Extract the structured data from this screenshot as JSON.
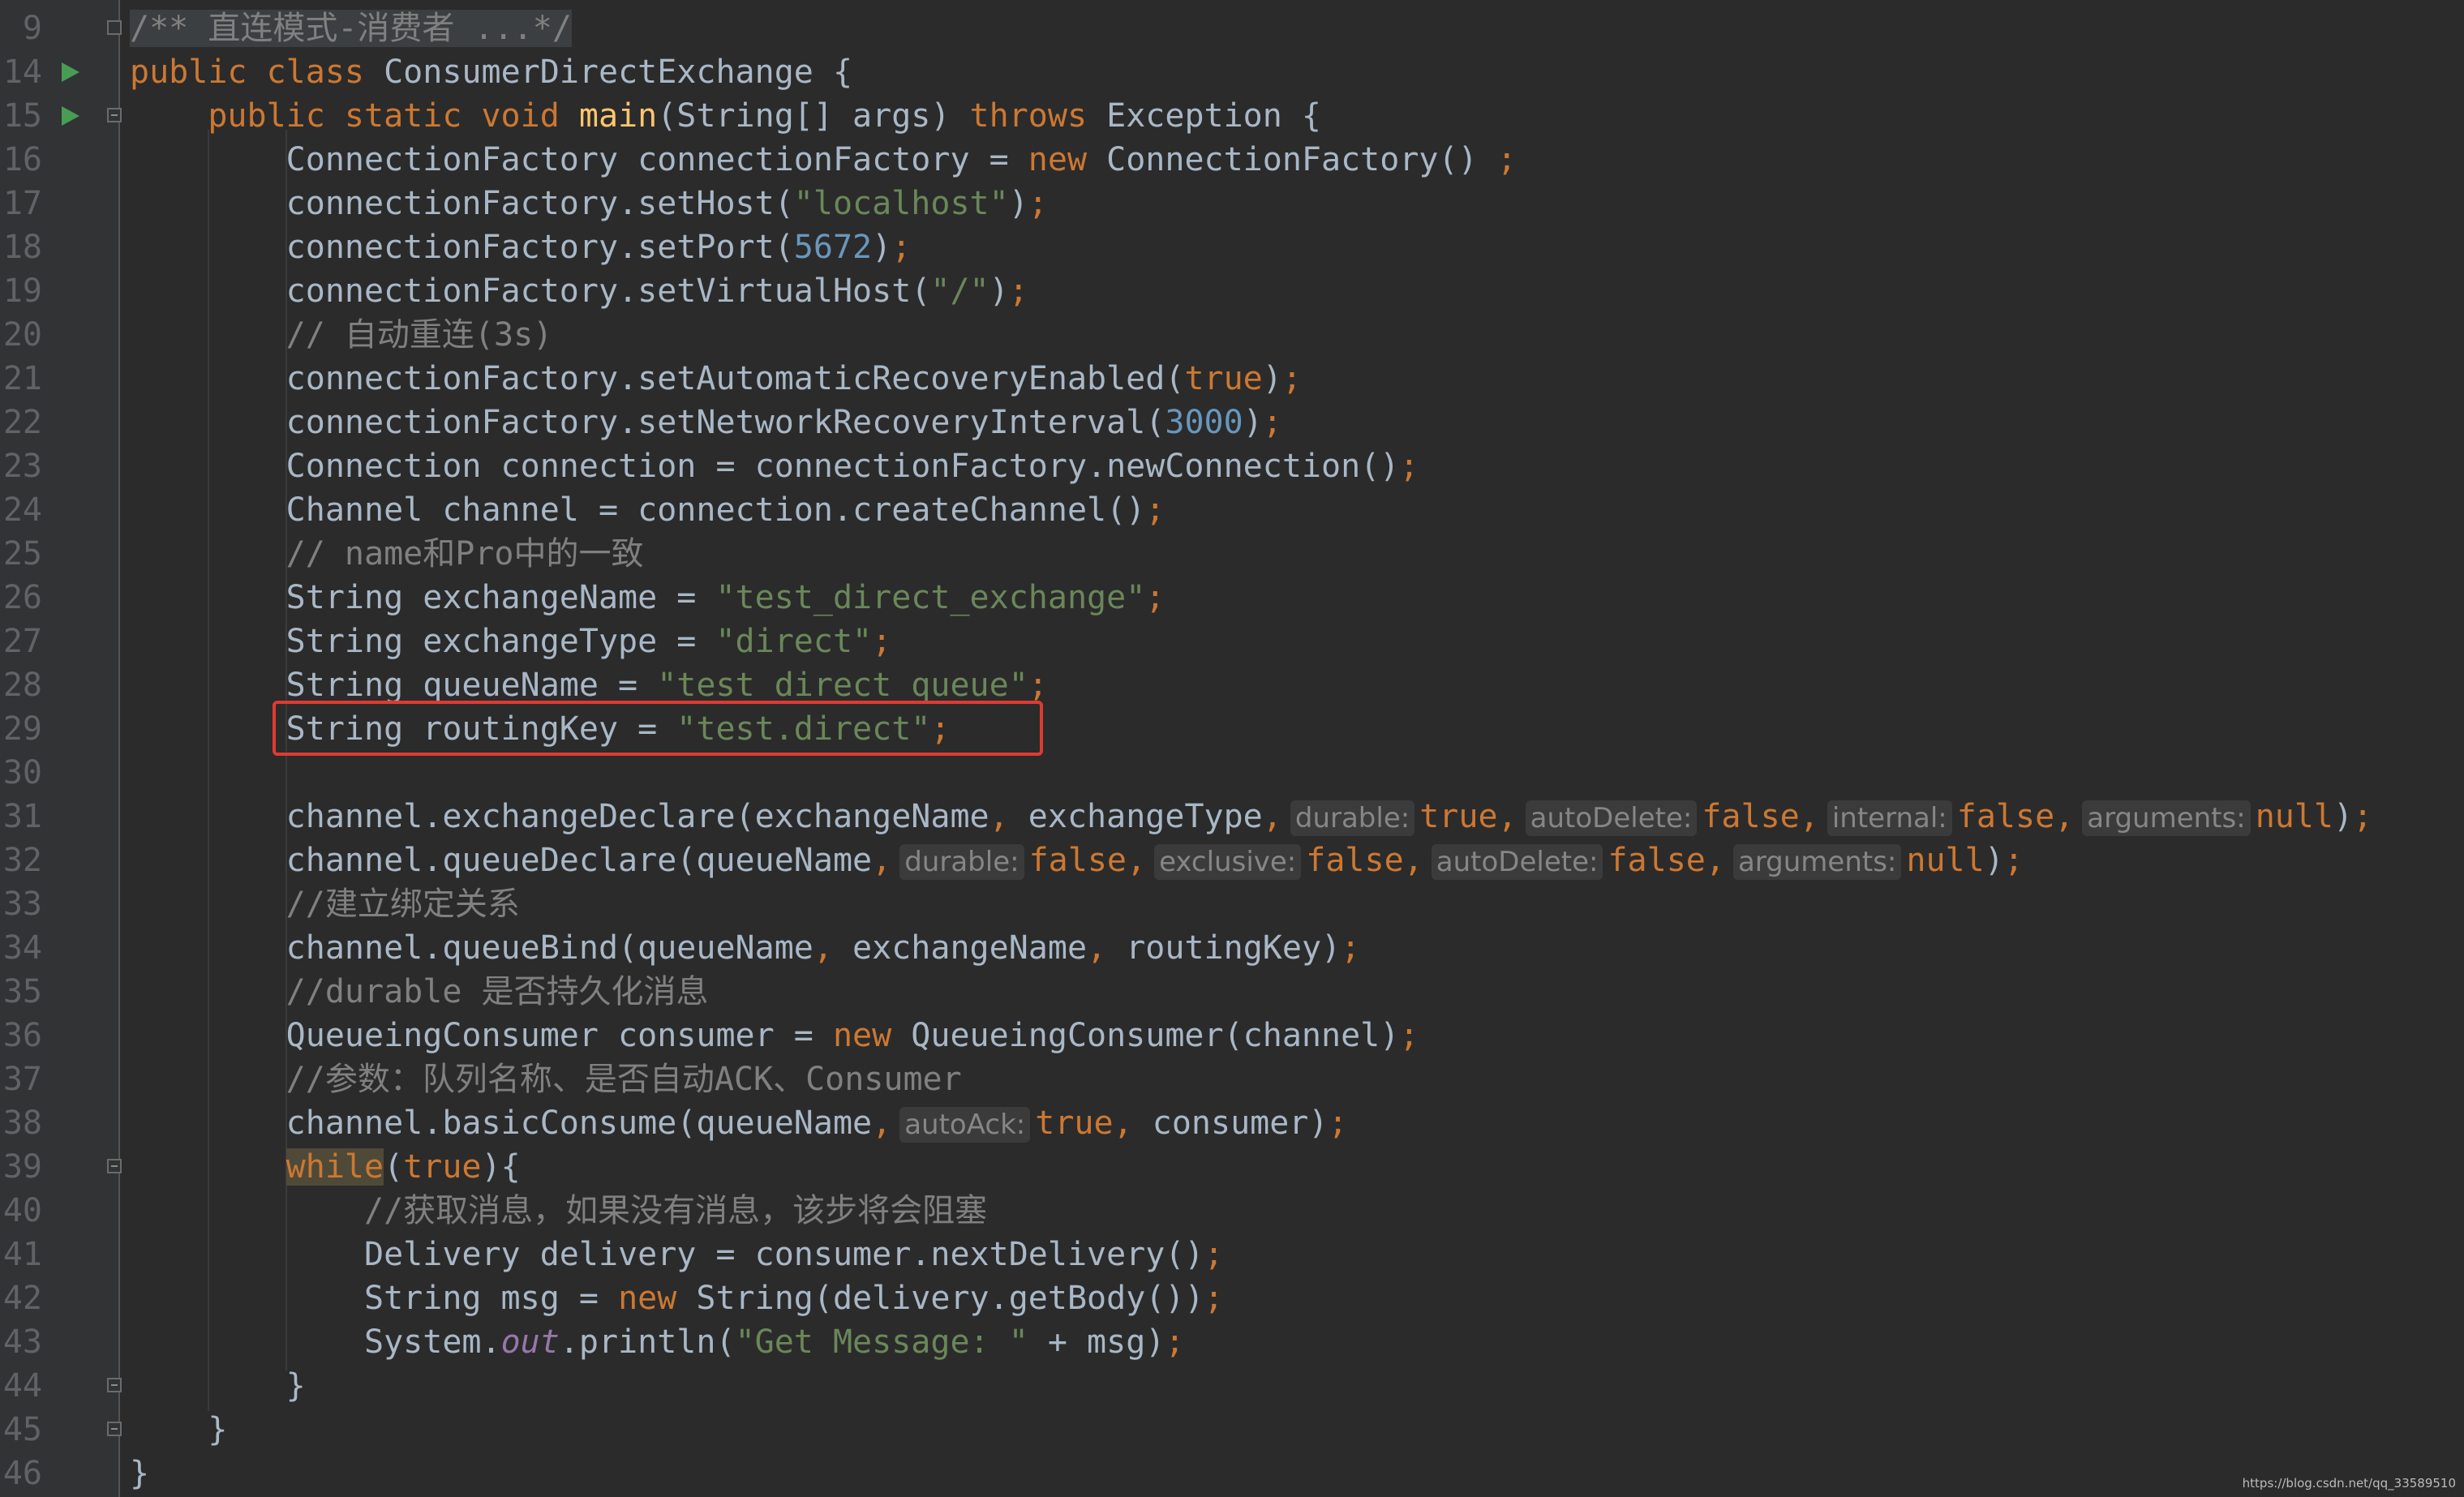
{
  "lines": [
    {
      "n": "9",
      "gutter": "fold-plus",
      "segs": [
        {
          "c": "fold-region cm",
          "t": "/** 直连模式-消费者 ...*/"
        }
      ]
    },
    {
      "n": "14",
      "gutter": "run",
      "segs": [
        {
          "c": "kw",
          "t": "public class "
        },
        {
          "c": "",
          "t": "ConsumerDirectExchange {"
        }
      ]
    },
    {
      "n": "15",
      "gutter": "run-fold",
      "segs": [
        {
          "c": "",
          "t": "    "
        },
        {
          "c": "kw",
          "t": "public static void "
        },
        {
          "c": "fn",
          "t": "main"
        },
        {
          "c": "",
          "t": "(String[] args) "
        },
        {
          "c": "kw",
          "t": "throws "
        },
        {
          "c": "",
          "t": "Exception {"
        }
      ]
    },
    {
      "n": "16",
      "segs": [
        {
          "c": "",
          "t": "        ConnectionFactory connectionFactory = "
        },
        {
          "c": "kw",
          "t": "new "
        },
        {
          "c": "",
          "t": "ConnectionFactory() "
        },
        {
          "c": "kw",
          "t": ";"
        }
      ]
    },
    {
      "n": "17",
      "segs": [
        {
          "c": "",
          "t": "        connectionFactory.setHost("
        },
        {
          "c": "str",
          "t": "\"localhost\""
        },
        {
          "c": "",
          "t": ")"
        },
        {
          "c": "kw",
          "t": ";"
        }
      ]
    },
    {
      "n": "18",
      "segs": [
        {
          "c": "",
          "t": "        connectionFactory.setPort("
        },
        {
          "c": "num",
          "t": "5672"
        },
        {
          "c": "",
          "t": ")"
        },
        {
          "c": "kw",
          "t": ";"
        }
      ]
    },
    {
      "n": "19",
      "segs": [
        {
          "c": "",
          "t": "        connectionFactory.setVirtualHost("
        },
        {
          "c": "str",
          "t": "\"/\""
        },
        {
          "c": "",
          "t": ")"
        },
        {
          "c": "kw",
          "t": ";"
        }
      ]
    },
    {
      "n": "20",
      "segs": [
        {
          "c": "cm",
          "t": "        // 自动重连(3s)"
        }
      ]
    },
    {
      "n": "21",
      "segs": [
        {
          "c": "",
          "t": "        connectionFactory.setAutomaticRecoveryEnabled("
        },
        {
          "c": "kw",
          "t": "true"
        },
        {
          "c": "",
          "t": ")"
        },
        {
          "c": "kw",
          "t": ";"
        }
      ]
    },
    {
      "n": "22",
      "segs": [
        {
          "c": "",
          "t": "        connectionFactory.setNetworkRecoveryInterval("
        },
        {
          "c": "num",
          "t": "3000"
        },
        {
          "c": "",
          "t": ")"
        },
        {
          "c": "kw",
          "t": ";"
        }
      ]
    },
    {
      "n": "23",
      "segs": [
        {
          "c": "",
          "t": "        Connection connection = connectionFactory.newConnection()"
        },
        {
          "c": "kw",
          "t": ";"
        }
      ]
    },
    {
      "n": "24",
      "segs": [
        {
          "c": "",
          "t": "        Channel channel = connection.createChannel()"
        },
        {
          "c": "kw",
          "t": ";"
        }
      ]
    },
    {
      "n": "25",
      "segs": [
        {
          "c": "cm",
          "t": "        // name和Pro中的一致"
        }
      ]
    },
    {
      "n": "26",
      "segs": [
        {
          "c": "",
          "t": "        String exchangeName = "
        },
        {
          "c": "str",
          "t": "\"test_direct_exchange\""
        },
        {
          "c": "kw",
          "t": ";"
        }
      ]
    },
    {
      "n": "27",
      "segs": [
        {
          "c": "",
          "t": "        String exchangeType = "
        },
        {
          "c": "str",
          "t": "\"direct\""
        },
        {
          "c": "kw",
          "t": ";"
        }
      ]
    },
    {
      "n": "28",
      "segs": [
        {
          "c": "",
          "t": "        String queueName = "
        },
        {
          "c": "str",
          "t": "\"test_direct_queue\""
        },
        {
          "c": "kw",
          "t": ";"
        }
      ]
    },
    {
      "n": "29",
      "segs": [
        {
          "c": "",
          "t": "        String routingKey = "
        },
        {
          "c": "str",
          "t": "\"test.direct\""
        },
        {
          "c": "kw",
          "t": ";"
        }
      ]
    },
    {
      "n": "30",
      "segs": []
    },
    {
      "n": "31",
      "segs": [
        {
          "c": "",
          "t": "        channel.exchangeDeclare(exchangeName"
        },
        {
          "c": "kw",
          "t": ", "
        },
        {
          "c": "",
          "t": "exchangeType"
        },
        {
          "c": "kw",
          "t": ","
        },
        {
          "c": "hint",
          "t": "durable:"
        },
        {
          "c": "kw",
          "t": "true,"
        },
        {
          "c": "hint",
          "t": "autoDelete:"
        },
        {
          "c": "kw",
          "t": "false,"
        },
        {
          "c": "hint",
          "t": "internal:"
        },
        {
          "c": "kw",
          "t": "false,"
        },
        {
          "c": "hint",
          "t": "arguments:"
        },
        {
          "c": "kw",
          "t": "null"
        },
        {
          "c": "",
          "t": ")"
        },
        {
          "c": "kw",
          "t": ";"
        }
      ]
    },
    {
      "n": "32",
      "segs": [
        {
          "c": "",
          "t": "        channel.queueDeclare(queueName"
        },
        {
          "c": "kw",
          "t": ","
        },
        {
          "c": "hint",
          "t": "durable:"
        },
        {
          "c": "kw",
          "t": "false,"
        },
        {
          "c": "hint",
          "t": "exclusive:"
        },
        {
          "c": "kw",
          "t": "false,"
        },
        {
          "c": "hint",
          "t": "autoDelete:"
        },
        {
          "c": "kw",
          "t": "false,"
        },
        {
          "c": "hint",
          "t": "arguments:"
        },
        {
          "c": "kw",
          "t": "null"
        },
        {
          "c": "",
          "t": ")"
        },
        {
          "c": "kw",
          "t": ";"
        }
      ]
    },
    {
      "n": "33",
      "segs": [
        {
          "c": "cm",
          "t": "        //建立绑定关系"
        }
      ]
    },
    {
      "n": "34",
      "segs": [
        {
          "c": "",
          "t": "        channel.queueBind(queueName"
        },
        {
          "c": "kw",
          "t": ", "
        },
        {
          "c": "",
          "t": "exchangeName"
        },
        {
          "c": "kw",
          "t": ", "
        },
        {
          "c": "",
          "t": "routingKey)"
        },
        {
          "c": "kw",
          "t": ";"
        }
      ]
    },
    {
      "n": "35",
      "segs": [
        {
          "c": "cm",
          "t": "        //durable 是否持久化消息"
        }
      ]
    },
    {
      "n": "36",
      "segs": [
        {
          "c": "",
          "t": "        QueueingConsumer consumer = "
        },
        {
          "c": "kw",
          "t": "new "
        },
        {
          "c": "",
          "t": "QueueingConsumer(channel)"
        },
        {
          "c": "kw",
          "t": ";"
        }
      ]
    },
    {
      "n": "37",
      "segs": [
        {
          "c": "cm",
          "t": "        //参数：队列名称、是否自动ACK、Consumer"
        }
      ]
    },
    {
      "n": "38",
      "segs": [
        {
          "c": "",
          "t": "        channel.basicConsume(queueName"
        },
        {
          "c": "kw",
          "t": ","
        },
        {
          "c": "hint",
          "t": "autoAck:"
        },
        {
          "c": "kw",
          "t": "true, "
        },
        {
          "c": "",
          "t": "consumer)"
        },
        {
          "c": "kw",
          "t": ";"
        }
      ]
    },
    {
      "n": "39",
      "gutter": "fold",
      "segs": [
        {
          "c": "",
          "t": "        "
        },
        {
          "c": "kw kwhl",
          "t": "while"
        },
        {
          "c": "",
          "t": "("
        },
        {
          "c": "kw",
          "t": "true"
        },
        {
          "c": "",
          "t": "){"
        }
      ]
    },
    {
      "n": "40",
      "segs": [
        {
          "c": "cm",
          "t": "            //获取消息，如果没有消息，该步将会阻塞"
        }
      ]
    },
    {
      "n": "41",
      "segs": [
        {
          "c": "",
          "t": "            Delivery delivery = consumer.nextDelivery()"
        },
        {
          "c": "kw",
          "t": ";"
        }
      ]
    },
    {
      "n": "42",
      "segs": [
        {
          "c": "",
          "t": "            String msg = "
        },
        {
          "c": "kw",
          "t": "new "
        },
        {
          "c": "",
          "t": "String(delivery.getBody())"
        },
        {
          "c": "kw",
          "t": ";"
        }
      ]
    },
    {
      "n": "43",
      "segs": [
        {
          "c": "",
          "t": "            System."
        },
        {
          "c": "fld",
          "t": "out"
        },
        {
          "c": "",
          "t": ".println("
        },
        {
          "c": "str",
          "t": "\"Get Message: \""
        },
        {
          "c": "",
          "t": " + msg)"
        },
        {
          "c": "kw",
          "t": ";"
        }
      ]
    },
    {
      "n": "44",
      "gutter": "fold",
      "segs": [
        {
          "c": "",
          "t": "        }"
        }
      ]
    },
    {
      "n": "45",
      "gutter": "fold",
      "segs": [
        {
          "c": "",
          "t": "    }"
        }
      ]
    },
    {
      "n": "46",
      "segs": [
        {
          "c": "",
          "t": "}"
        }
      ]
    }
  ],
  "watermark": "https://blog.csdn.net/qq_33589510"
}
